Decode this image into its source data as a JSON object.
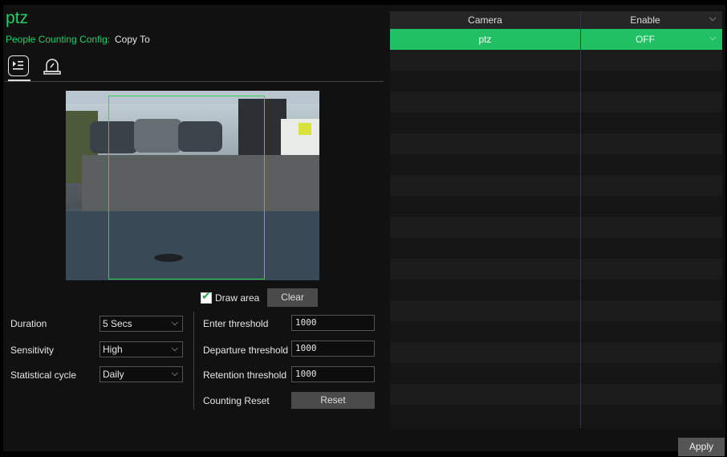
{
  "camera_name": "ptz",
  "config": {
    "label": "People Counting Config:",
    "copy_to": "Copy To"
  },
  "tabs": [
    {
      "name": "list-settings-icon",
      "active": true
    },
    {
      "name": "alarm-icon",
      "active": false
    }
  ],
  "draw_area": {
    "label": "Draw area",
    "checked": true,
    "clear_label": "Clear"
  },
  "left_fields": [
    {
      "label": "Duration",
      "value": "5 Secs"
    },
    {
      "label": "Sensitivity",
      "value": "High"
    },
    {
      "label": "Statistical cycle",
      "value": "Daily"
    }
  ],
  "right_fields": [
    {
      "label": "Enter threshold",
      "value": "1000"
    },
    {
      "label": "Departure threshold",
      "value": "1000"
    },
    {
      "label": "Retention threshold",
      "value": "1000"
    }
  ],
  "counting_reset": {
    "label": "Counting Reset",
    "button": "Reset"
  },
  "table": {
    "headers": [
      "Camera",
      "Enable"
    ],
    "rows": [
      {
        "camera": "ptz",
        "enable": "OFF"
      }
    ]
  },
  "apply_label": "Apply",
  "colors": {
    "accent": "#22c064",
    "title": "#1fcf6a"
  }
}
